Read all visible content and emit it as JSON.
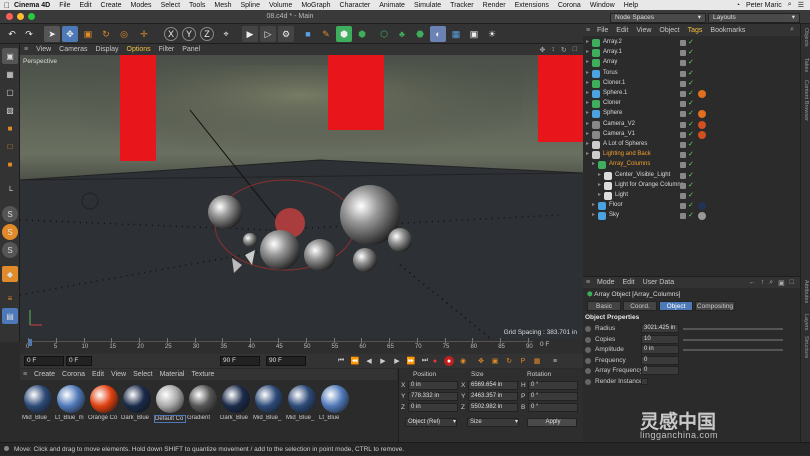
{
  "macbar": {
    "app": "Cinema 4D",
    "menus": [
      "File",
      "Edit",
      "Create",
      "Modes",
      "Select",
      "Tools",
      "Mesh",
      "Spline",
      "Volume",
      "MoGraph",
      "Character",
      "Animate",
      "Simulate",
      "Tracker",
      "Render",
      "Extensions",
      "Corona",
      "Window",
      "Help"
    ],
    "user": "Peter Maric"
  },
  "window": {
    "title": "08.c4d * - Main",
    "node_spaces": "Node Spaces",
    "layouts": "Layouts"
  },
  "viewport": {
    "menu": [
      "View",
      "Cameras",
      "Display",
      "Options",
      "Filter",
      "Panel"
    ],
    "label": "Perspective",
    "grid_spacing": "Grid Spacing : 383.701 in"
  },
  "timeline": {
    "ticks": [
      "0",
      "5",
      "10",
      "15",
      "20",
      "25",
      "30",
      "35",
      "40",
      "45",
      "50",
      "55",
      "60",
      "65",
      "70",
      "75",
      "80",
      "85",
      "90"
    ],
    "end_frame_label": "0 F",
    "current_frame": "0 F",
    "start_field": "0 F",
    "end_field": "90 F",
    "max_field": "90 F"
  },
  "materials": {
    "menu": [
      "Create",
      "Corona",
      "Edit",
      "View",
      "Select",
      "Material",
      "Texture"
    ],
    "items": [
      {
        "name": "Mid_Blue_",
        "color": "#2d4a78"
      },
      {
        "name": "Lt_Blue_m",
        "color": "#4f78b8"
      },
      {
        "name": "Orange Co",
        "color": "#e04010"
      },
      {
        "name": "Dark_Blue",
        "color": "#1a2a4a"
      },
      {
        "name": "Default Co",
        "color": "#a8a8a8"
      },
      {
        "name": "Gradient",
        "color": "#555555"
      },
      {
        "name": "Dark_Blue",
        "color": "#1a2a4a"
      },
      {
        "name": "Mid_Blue_",
        "color": "#2d4a78"
      },
      {
        "name": "Mid_Blue_",
        "color": "#2d4a78"
      },
      {
        "name": "Lt_Blue",
        "color": "#4f78b8"
      }
    ]
  },
  "coords": {
    "headers": {
      "position": "Position",
      "size": "Size",
      "rotation": "Rotation"
    },
    "rows": [
      {
        "axis": "X",
        "pos": "0 in",
        "size_axis": "X",
        "size": "6569.654 in",
        "rot_axis": "H",
        "rot": "0 °"
      },
      {
        "axis": "Y",
        "pos": "778.332 in",
        "size_axis": "Y",
        "size": "2463.357 in",
        "rot_axis": "P",
        "rot": "0 °"
      },
      {
        "axis": "Z",
        "pos": "0 in",
        "size_axis": "Z",
        "size": "5502.982 in",
        "rot_axis": "B",
        "rot": "0 °"
      }
    ],
    "mode": "Object (Rel)",
    "size_mode": "Size",
    "apply": "Apply"
  },
  "objects": {
    "menu": [
      "File",
      "Edit",
      "View",
      "Object",
      "Tags",
      "Bookmarks"
    ],
    "items": [
      {
        "name": "Array.2",
        "icon": "array-icon",
        "color": "#3fae5c",
        "indent": 0,
        "tag": ""
      },
      {
        "name": "Array.1",
        "icon": "array-icon",
        "color": "#3fae5c",
        "indent": 0,
        "tag": ""
      },
      {
        "name": "Array",
        "icon": "array-icon",
        "color": "#3fae5c",
        "indent": 0,
        "tag": ""
      },
      {
        "name": "Torus",
        "icon": "torus-icon",
        "color": "#4aa3e0",
        "indent": 0,
        "tag": ""
      },
      {
        "name": "Cloner.1",
        "icon": "cloner-icon",
        "color": "#3fae5c",
        "indent": 0,
        "tag": ""
      },
      {
        "name": "Sphere.1",
        "icon": "sphere-icon",
        "color": "#4aa3e0",
        "indent": 0,
        "tag": "#e07020"
      },
      {
        "name": "Cloner",
        "icon": "cloner-icon",
        "color": "#3fae5c",
        "indent": 0,
        "tag": ""
      },
      {
        "name": "Sphere",
        "icon": "sphere-icon",
        "color": "#4aa3e0",
        "indent": 0,
        "tag": "#e07020"
      },
      {
        "name": "Camera_V2",
        "icon": "camera-icon",
        "color": "#888888",
        "indent": 0,
        "tag": "#d05020"
      },
      {
        "name": "Camera_V1",
        "icon": "camera-icon",
        "color": "#888888",
        "indent": 0,
        "tag": "#d05020"
      },
      {
        "name": "A Lot of Spheres",
        "icon": "null-icon",
        "color": "#cccccc",
        "indent": 0,
        "tag": ""
      },
      {
        "name": "Lighting and Back",
        "icon": "null-icon",
        "color": "#cccccc",
        "indent": 0,
        "tag": "",
        "orange": true
      },
      {
        "name": "Array_Columns",
        "icon": "array-icon",
        "color": "#3fae5c",
        "indent": 1,
        "tag": "",
        "orange": true
      },
      {
        "name": "Center_Visible_Light",
        "icon": "light-icon",
        "color": "#dddddd",
        "indent": 2,
        "tag": ""
      },
      {
        "name": "Light for Orange Columns",
        "icon": "light-icon",
        "color": "#dddddd",
        "indent": 2,
        "tag": ""
      },
      {
        "name": "Light",
        "icon": "light-icon",
        "color": "#dddddd",
        "indent": 2,
        "tag": ""
      },
      {
        "name": "Floor",
        "icon": "floor-icon",
        "color": "#4aa3e0",
        "indent": 1,
        "tag": "#223355"
      },
      {
        "name": "Sky",
        "icon": "sky-icon",
        "color": "#4aa3e0",
        "indent": 1,
        "tag": "#999999"
      }
    ]
  },
  "attributes": {
    "menu": [
      "Mode",
      "Edit",
      "User Data"
    ],
    "title": "Array Object [Array_Columns]",
    "tabs": [
      "Basic",
      "Coord.",
      "Object",
      "Compositing"
    ],
    "active_tab": "Object",
    "section": "Object Properties",
    "props": [
      {
        "label": "Radius",
        "value": "3021.425 in"
      },
      {
        "label": "Copies",
        "value": "10"
      },
      {
        "label": "Amplitude",
        "value": "0 in"
      },
      {
        "label": "Frequency",
        "value": "0"
      },
      {
        "label": "Array Frequency",
        "value": "0"
      },
      {
        "label": "Render Instances",
        "value": ""
      }
    ]
  },
  "side_tabs": [
    "Objects",
    "Takes",
    "Content Browser",
    "Attributes",
    "Layers",
    "Structure"
  ],
  "status": "Move: Click and drag to move elements. Hold down SHIFT to quantize movement / add to the selection in point mode, CTRL to remove.",
  "watermark": {
    "cn": "灵感中国",
    "url": "lingganchina.com"
  }
}
